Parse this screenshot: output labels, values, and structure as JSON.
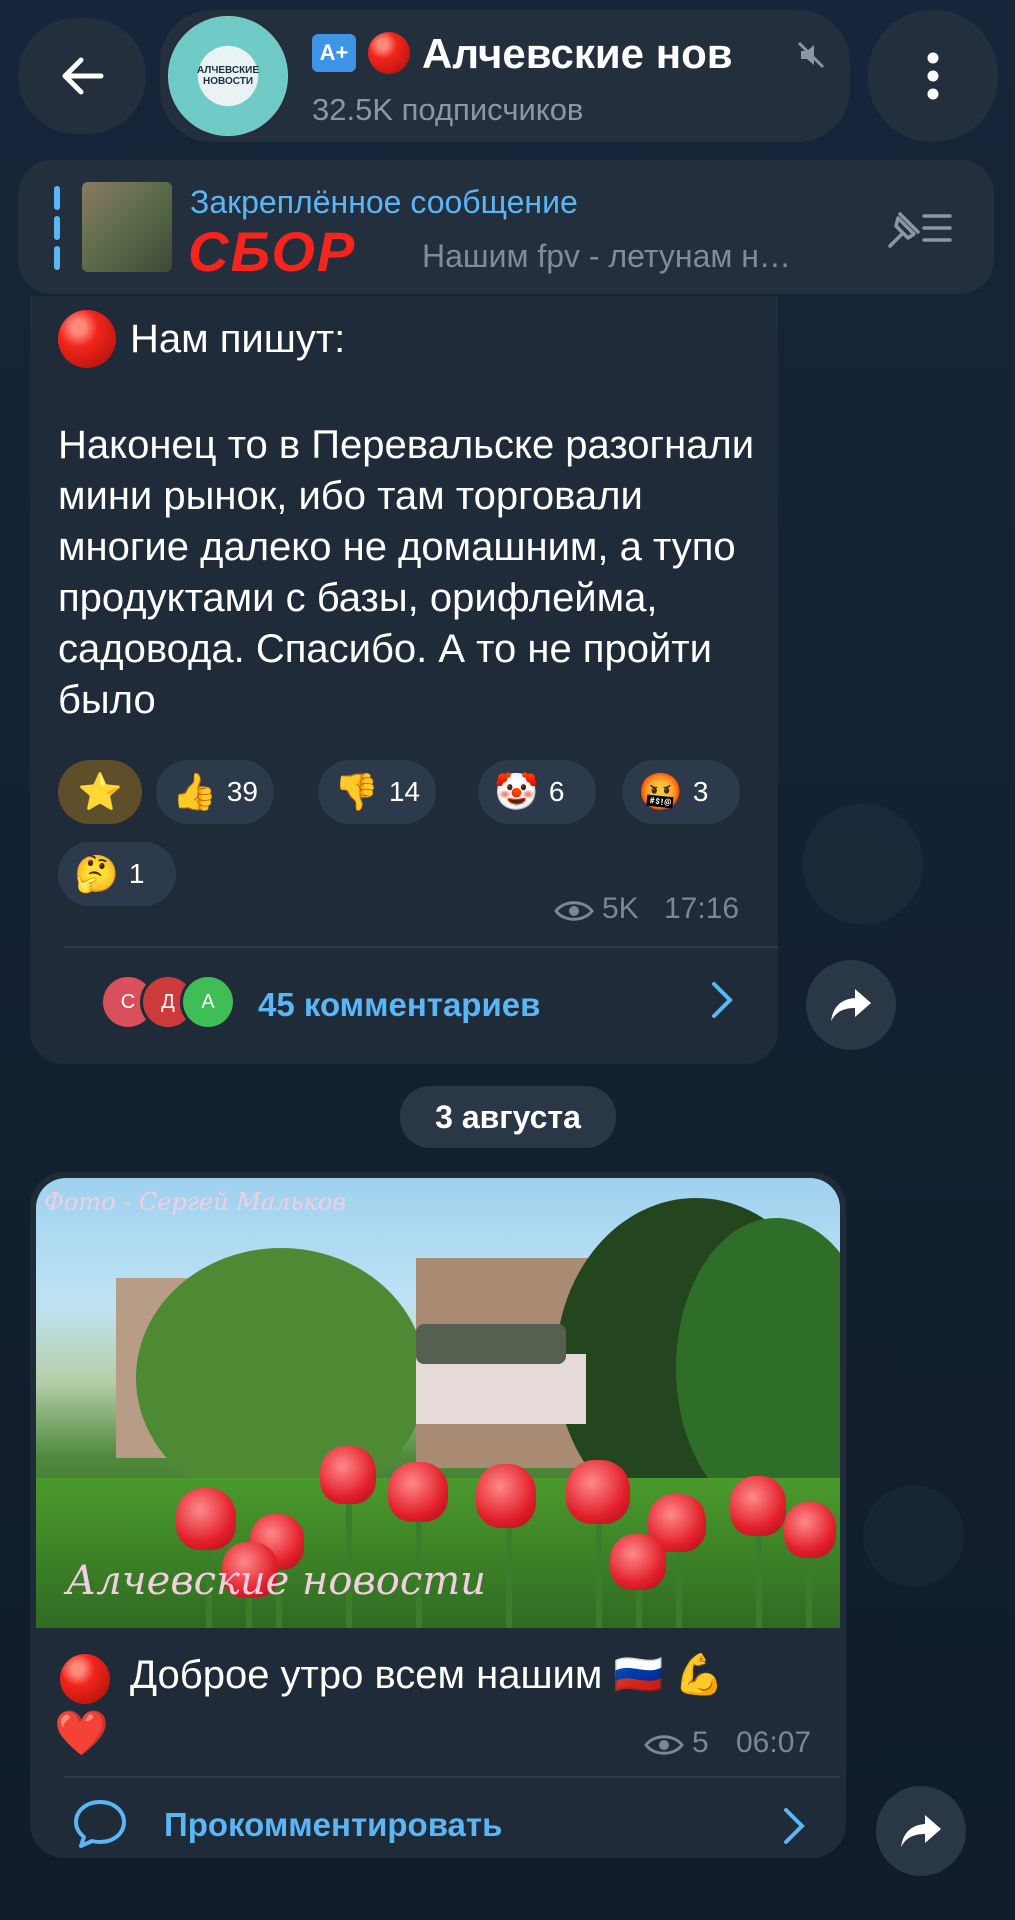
{
  "header": {
    "title": "Алчевские нов",
    "subscribers": "32.5K подписчиков",
    "avatar_text": "АЛЧЕВСКИЕ НОВОСТИ",
    "badge": "A+"
  },
  "pinned": {
    "title": "Закреплённое сообщение",
    "image_text": "СБОР",
    "preview": "Нашим fpv - летунам н…"
  },
  "post1": {
    "intro": "Нам пишут:",
    "body": "Наконец то в Перевальске разогнали мини рынок, ибо там торговали многие далеко не домашним, а тупо продуктами с базы, орифлейма, садовода. Спасибо. А то не пройти было",
    "reactions": [
      {
        "emoji": "⭐",
        "count": ""
      },
      {
        "emoji": "👍",
        "count": "39"
      },
      {
        "emoji": "👎",
        "count": "14"
      },
      {
        "emoji": "🤡",
        "count": "6"
      },
      {
        "emoji": "🤬",
        "count": "3"
      },
      {
        "emoji": "🤔",
        "count": "1"
      }
    ],
    "views": "5K",
    "time": "17:16",
    "comments": "45 комментариев",
    "commenter_initials": [
      "С",
      "Д",
      "А"
    ]
  },
  "date_separator": "3 августа",
  "post2": {
    "photo_watermark_top": "Фото - Сергей Мальков",
    "photo_watermark_bottom": "Алчевские новости",
    "text": "Доброе утро всем нашим 🇷🇺 💪",
    "heart": "❤️",
    "views": "5",
    "time": "06:07",
    "comment_action": "Прокомментировать"
  },
  "colors": {
    "background": "#152231",
    "bubble": "#1f2b39",
    "accent": "#5ab6f5"
  }
}
